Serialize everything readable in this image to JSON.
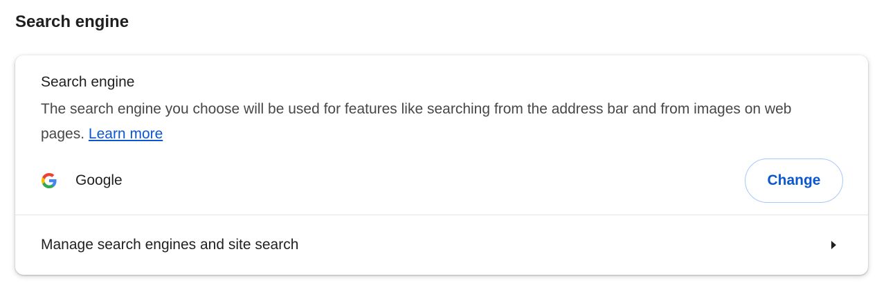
{
  "section": {
    "heading": "Search engine"
  },
  "card": {
    "title": "Search engine",
    "description": "The search engine you choose will be used for features like searching from the address bar and from images on web pages.",
    "learn_more": "Learn more",
    "engine": {
      "name": "Google",
      "icon": "google-g-icon"
    },
    "change_label": "Change",
    "manage_label": "Manage search engines and site search",
    "manage_icon": "arrow-right-icon"
  },
  "colors": {
    "link": "#0b57d0",
    "button_border": "#a8c7fa",
    "text_primary": "#1f1f1f",
    "text_secondary": "#474747"
  }
}
